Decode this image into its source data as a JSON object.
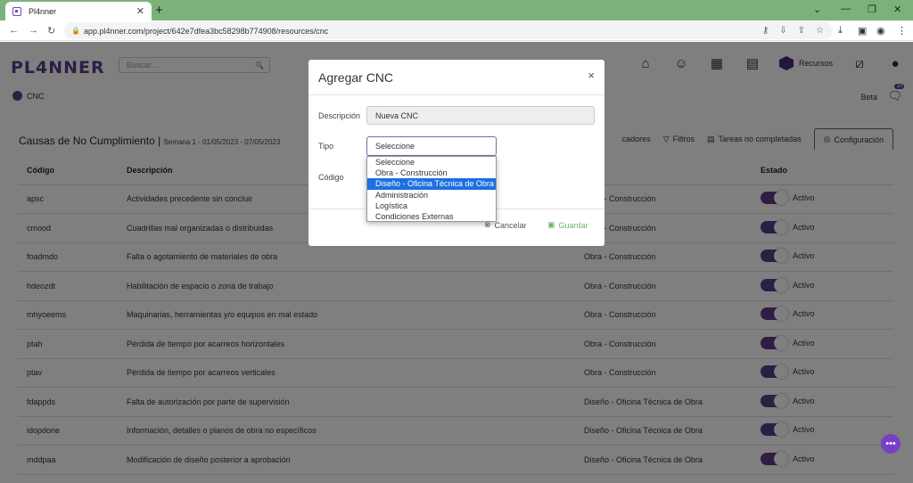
{
  "browser": {
    "tab_title": "Pl4nner",
    "url": "app.pl4nner.com/project/642e7dfea3bc58298b774908/resources/cnc"
  },
  "header": {
    "logo": "PL4NNER",
    "search_placeholder": "Buscar...",
    "recursos_label": "Recursos",
    "notification_count": "10",
    "beta_label": "Beta"
  },
  "breadcrumb": {
    "label": "CNC"
  },
  "page": {
    "title": "Causas de No Cumplimiento |",
    "subtitle": "Semana 1 - 01/05/2023 - 07/05/2023"
  },
  "toolbar": {
    "indicadores_label": "cadores",
    "filtros_label": "Filtros",
    "tareas_label": "Tareas no completadas",
    "config_label": "Configuración"
  },
  "table": {
    "headers": [
      "Código",
      "Descripción",
      "",
      "Estado"
    ],
    "status_label": "Activo",
    "rows": [
      {
        "code": "apsc",
        "desc": "Actividades precedente sin concluir",
        "type": "Obra - Construcción"
      },
      {
        "code": "cmood",
        "desc": "Cuadrillas mal organizadas o distribuidas",
        "type": "Obra - Construcción"
      },
      {
        "code": "foadmdo",
        "desc": "Falta o agotamiento de materiales de obra",
        "type": "Obra - Construcción"
      },
      {
        "code": "hdeozdt",
        "desc": "Habilitación de espacio o zona de trabajo",
        "type": "Obra - Construcción"
      },
      {
        "code": "mhyoeems",
        "desc": "Maquinarias, herramientas y/o equipos en mal estado",
        "type": "Obra - Construcción"
      },
      {
        "code": "ptah",
        "desc": "Pérdida de tiempo por acarreos horizontales",
        "type": "Obra - Construcción"
      },
      {
        "code": "ptav",
        "desc": "Pérdida de tiempo por acarreos verticales",
        "type": "Obra - Construcción"
      },
      {
        "code": "fdappds",
        "desc": "Falta de autorización por parte de supervisión",
        "type": "Diseño - Oficina Técnica de Obra"
      },
      {
        "code": "idopdone",
        "desc": "Información, detalles o planos de obra no específicos",
        "type": "Diseño - Oficina Técnica de Obra"
      },
      {
        "code": "mddpaa",
        "desc": "Modificación de diseño posterior a aprobación",
        "type": "Diseño - Oficina Técnica de Obra"
      }
    ]
  },
  "modal": {
    "title": "Agregar CNC",
    "desc_label": "Descripción",
    "desc_value": "Nueva CNC",
    "tipo_label": "Tipo",
    "tipo_value": "Seleccione",
    "codigo_label": "Código",
    "cancel_label": "Cancelar",
    "save_label": "Guardar",
    "options": [
      "Seleccione",
      "Obra - Construcción",
      "Diseño - Oficina Técnica de Obra",
      "Administración",
      "Logística",
      "Condiciones Externas"
    ]
  },
  "colors": {
    "brand": "#5a3d8c",
    "accent": "#1e6fe0",
    "save": "#6ab56a"
  }
}
